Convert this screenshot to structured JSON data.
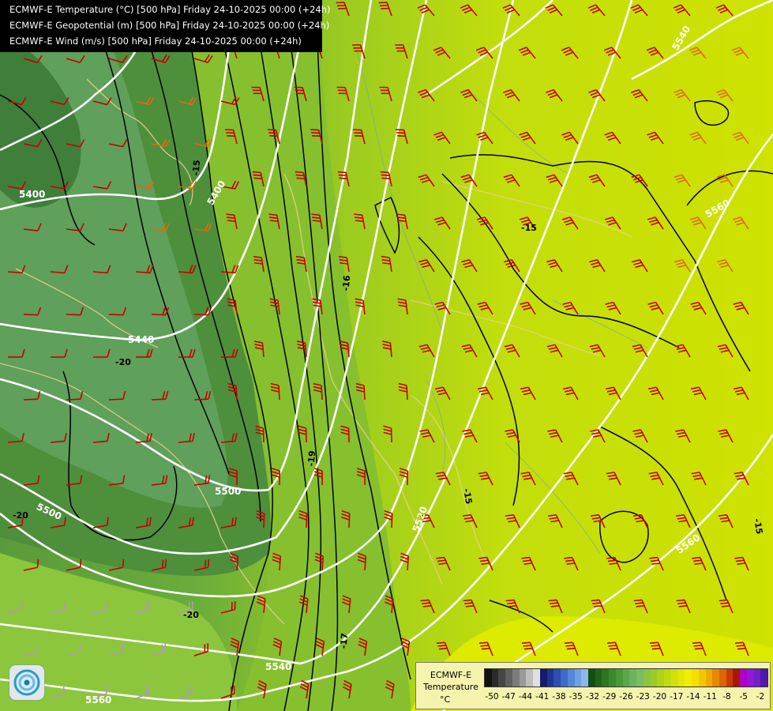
{
  "header": {
    "line1": "ECMWF-E Temperature (°C) [500 hPa] Friday 24-10-2025 00:00 (+24h)",
    "line2": "ECMWF-E Geopotential (m) [500 hPa] Friday 24-10-2025 00:00 (+24h)",
    "line3": "ECMWF-E Wind (m/s) [500 hPa] Friday 24-10-2025 00:00 (+24h)"
  },
  "legend": {
    "name": "ECMWF-E",
    "variable": "Temperature",
    "unit": "°C",
    "tick_labels": [
      "-50",
      "-47",
      "-44",
      "-41",
      "-38",
      "-35",
      "-32",
      "-29",
      "-26",
      "-23",
      "-20",
      "-17",
      "-14",
      "-11",
      "-8",
      "-5",
      "-2"
    ],
    "colors": [
      "#111111",
      "#2b2b2b",
      "#454545",
      "#606060",
      "#7c7c7c",
      "#9a9a9a",
      "#bdbdbd",
      "#e0e0e0",
      "#141c6b",
      "#1f3590",
      "#2d4fb0",
      "#3d6bc9",
      "#5586d8",
      "#6fa0e2",
      "#8cb8ea",
      "#105010",
      "#1f6418",
      "#2c7820",
      "#3a8a2c",
      "#4a9a3a",
      "#5aa84a",
      "#6bb45a",
      "#79bf62",
      "#8cc63c",
      "#9ccb28",
      "#aed21a",
      "#c0da10",
      "#d2e208",
      "#e2e804",
      "#f0ee00",
      "#f4e000",
      "#f2c800",
      "#eeaa00",
      "#e88800",
      "#dc6600",
      "#c83c00",
      "#a81800",
      "#b000c8",
      "#9018d8",
      "#7020c8",
      "#5018a8"
    ]
  },
  "contours": {
    "geopotential_labels": [
      "5400",
      "5400",
      "5440",
      "5500",
      "5500",
      "5520",
      "5540",
      "5540",
      "5560",
      "5560",
      "5560"
    ],
    "temperature_labels": [
      "-15",
      "-16",
      "-19",
      "-15",
      "-17",
      "-15",
      "-20",
      "-20",
      "-20",
      "-15"
    ]
  },
  "icons": [
    "ecmwf-logo-icon",
    "wind-barb-icon"
  ]
}
